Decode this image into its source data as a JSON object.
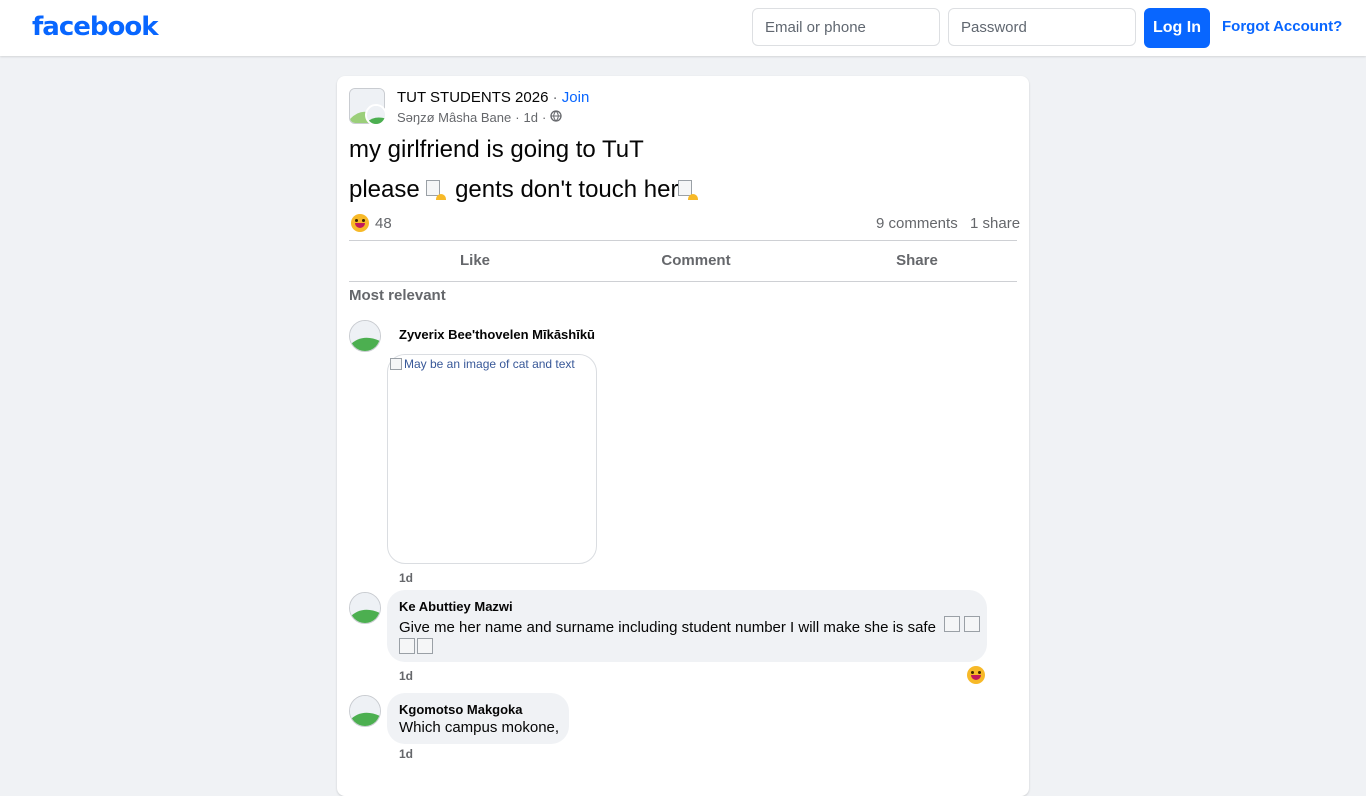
{
  "brand": {
    "name": "facebook",
    "color": "#0866ff"
  },
  "login": {
    "email_placeholder": "Email or phone",
    "password_placeholder": "Password",
    "login_label": "Log In",
    "forgot_label": "Forgot Account?"
  },
  "post": {
    "group_name": "TUT STUDENTS 2026",
    "separator": " · ",
    "join_label": "Join",
    "author": "Sәŋzø Mâsha Bane",
    "time": "1d",
    "audience_icon": "globe-icon",
    "line1": "my girlfriend is going to TuT",
    "line2_a": "please",
    "line2_b": "gents don't touch her",
    "reaction_icon": "haha-reaction-icon",
    "reaction_count": "48",
    "comments_count": "9 comments",
    "shares_count": "1 share"
  },
  "actions": {
    "like": "Like",
    "comment": "Comment",
    "share": "Share"
  },
  "comments_section": {
    "sort_label": "Most relevant",
    "comments": [
      {
        "name": "Zyverix Bee'thovelen Mīkāshīkū",
        "image_alt": "May be an image of cat and text",
        "time": "1d"
      },
      {
        "name": "Ke Abuttiey Mazwi",
        "text": "Give me her name and surname including student number I will make she is safe",
        "time": "1d",
        "reaction_icon": "haha-reaction-icon"
      },
      {
        "name": "Kgomotso Makgoka",
        "text": "Which campus mokone,",
        "time": "1d"
      }
    ]
  }
}
